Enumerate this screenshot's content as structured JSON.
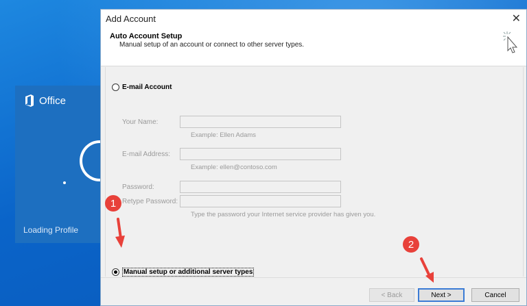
{
  "office": {
    "logo_text": "Office",
    "status": "Loading Profile"
  },
  "dialog": {
    "title": "Add Account",
    "close_glyph": "✕",
    "header_title": "Auto Account Setup",
    "header_subtitle": "Manual setup of an account or connect to other server types."
  },
  "email_option": {
    "label": "E-mail Account",
    "selected": false
  },
  "fields": {
    "name_label": "Your Name:",
    "name_hint": "Example: Ellen Adams",
    "email_label": "E-mail Address:",
    "email_hint": "Example: ellen@contoso.com",
    "password_label": "Password:",
    "retype_label": "Retype Password:",
    "password_hint": "Type the password your Internet service provider has given you."
  },
  "manual_option": {
    "label": "Manual setup or additional server types",
    "selected": true
  },
  "buttons": {
    "back": "< Back",
    "next": "Next >",
    "cancel": "Cancel"
  },
  "annotations": {
    "step1": "1",
    "step2": "2"
  },
  "colors": {
    "desktop_blue": "#0a64c9",
    "office_blue": "#1d6fc0",
    "annotation_red": "#e8413a",
    "default_button_border": "#3a7bd5"
  }
}
